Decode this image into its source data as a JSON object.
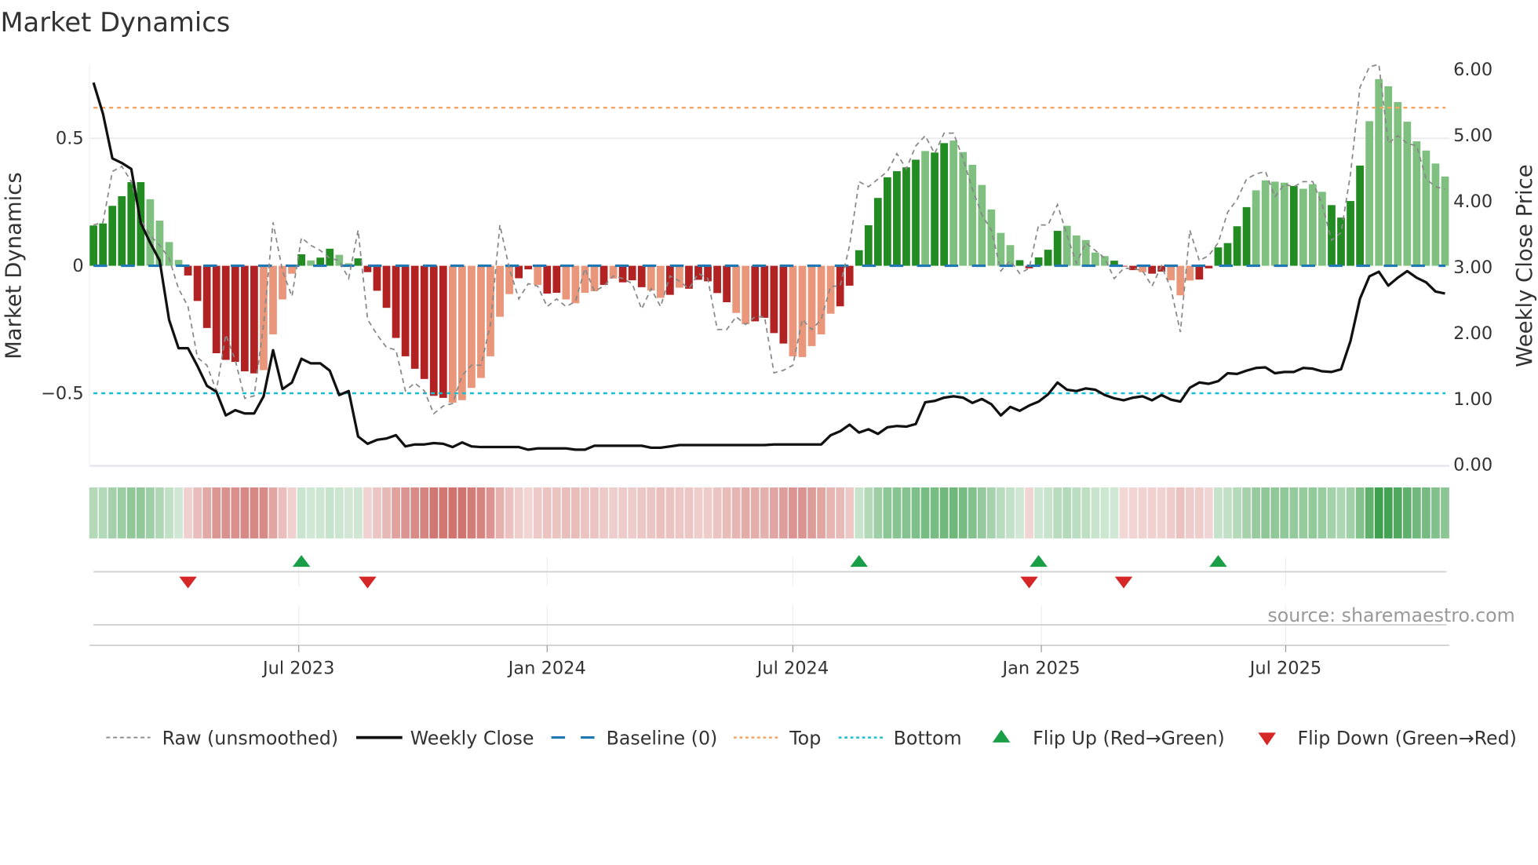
{
  "chart_data": {
    "type": "bar",
    "title": "Market Dynamics",
    "ylabel": "Market Dynamics",
    "ylabel_right": "Weekly Close Price",
    "frequency": "weekly",
    "start_week": "2023-01-30",
    "ylim": [
      -0.78,
      0.79
    ],
    "ylim_right": [
      0,
      6.1
    ],
    "yticks": [
      {
        "v": 0.5,
        "label": "0.5"
      },
      {
        "v": 0,
        "label": "0"
      },
      {
        "v": -0.5,
        "label": "−0.5"
      }
    ],
    "yticks_right": [
      {
        "v": 6,
        "label": "6.00"
      },
      {
        "v": 5,
        "label": "5.00"
      },
      {
        "v": 4,
        "label": "4.00"
      },
      {
        "v": 3,
        "label": "3.00"
      },
      {
        "v": 2,
        "label": "2.00"
      },
      {
        "v": 1,
        "label": "1.00"
      },
      {
        "v": 0,
        "label": "0.00"
      }
    ],
    "xticks": [
      {
        "date": "2023-07-01",
        "label": "Jul 2023"
      },
      {
        "date": "2024-01-01",
        "label": "Jan 2024"
      },
      {
        "date": "2024-07-01",
        "label": "Jul 2024"
      },
      {
        "date": "2025-01-01",
        "label": "Jan 2025"
      },
      {
        "date": "2025-07-01",
        "label": "Jul 2025"
      }
    ],
    "top_level": 0.62,
    "bottom_level": -0.5,
    "baseline": 0,
    "values": [
      0.158,
      0.166,
      0.235,
      0.273,
      0.328,
      0.328,
      0.261,
      0.177,
      0.093,
      0.023,
      -0.038,
      -0.138,
      -0.244,
      -0.343,
      -0.369,
      -0.377,
      -0.414,
      -0.422,
      -0.409,
      -0.269,
      -0.132,
      -0.031,
      0.045,
      0.021,
      0.032,
      0.067,
      0.043,
      0.01,
      0.029,
      -0.025,
      -0.098,
      -0.165,
      -0.283,
      -0.355,
      -0.404,
      -0.444,
      -0.51,
      -0.518,
      -0.537,
      -0.527,
      -0.479,
      -0.44,
      -0.355,
      -0.2,
      -0.111,
      -0.049,
      -0.014,
      -0.075,
      -0.109,
      -0.106,
      -0.132,
      -0.147,
      -0.106,
      -0.1,
      -0.075,
      -0.05,
      -0.065,
      -0.057,
      -0.084,
      -0.097,
      -0.126,
      -0.114,
      -0.086,
      -0.09,
      -0.055,
      -0.061,
      -0.107,
      -0.143,
      -0.185,
      -0.229,
      -0.218,
      -0.204,
      -0.264,
      -0.305,
      -0.355,
      -0.358,
      -0.315,
      -0.269,
      -0.188,
      -0.159,
      -0.078,
      0.061,
      0.159,
      0.266,
      0.347,
      0.371,
      0.386,
      0.416,
      0.45,
      0.444,
      0.481,
      0.491,
      0.446,
      0.396,
      0.317,
      0.221,
      0.129,
      0.081,
      0.022,
      -0.01,
      0.033,
      0.063,
      0.137,
      0.157,
      0.119,
      0.101,
      0.052,
      0.038,
      0.02,
      -0.003,
      -0.017,
      -0.025,
      -0.031,
      -0.023,
      -0.057,
      -0.116,
      -0.058,
      -0.054,
      -0.01,
      0.072,
      0.089,
      0.155,
      0.23,
      0.296,
      0.335,
      0.33,
      0.326,
      0.313,
      0.302,
      0.32,
      0.29,
      0.238,
      0.189,
      0.254,
      0.393,
      0.567,
      0.732,
      0.704,
      0.642,
      0.565,
      0.488,
      0.452,
      0.401,
      0.35
    ],
    "shade": "sssssswwwwsssssssswwwwswsswwsssssssssswwwwwwwsswsswwwwswssswwswssssswwsssswwwwwssssssssswsswwwwwwwssssswwwwwssswsswwwsssssswwwwswwwsssswwwwwww",
    "raw": [
      0.16,
      0.17,
      0.37,
      0.39,
      0.33,
      0.18,
      0.12,
      0.08,
      0.03,
      -0.09,
      -0.16,
      -0.36,
      -0.39,
      -0.49,
      -0.27,
      -0.37,
      -0.52,
      -0.51,
      -0.23,
      0.17,
      -0.02,
      -0.12,
      0.11,
      0.08,
      0.06,
      0.03,
      0.02,
      -0.05,
      0.14,
      -0.21,
      -0.27,
      -0.32,
      -0.33,
      -0.49,
      -0.46,
      -0.49,
      -0.58,
      -0.55,
      -0.54,
      -0.43,
      -0.39,
      -0.39,
      -0.23,
      0.16,
      -0.01,
      -0.13,
      -0.07,
      -0.08,
      -0.16,
      -0.13,
      -0.16,
      -0.14,
      -0.01,
      -0.1,
      -0.08,
      -0.04,
      -0.05,
      -0.07,
      -0.17,
      -0.09,
      -0.16,
      -0.04,
      -0.06,
      -0.09,
      -0.03,
      -0.05,
      -0.25,
      -0.25,
      -0.2,
      -0.23,
      -0.2,
      -0.2,
      -0.42,
      -0.41,
      -0.39,
      -0.21,
      -0.25,
      -0.21,
      -0.08,
      -0.08,
      0.08,
      0.33,
      0.31,
      0.34,
      0.37,
      0.44,
      0.38,
      0.47,
      0.51,
      0.44,
      0.52,
      0.52,
      0.42,
      0.3,
      0.2,
      0.14,
      -0.02,
      0.02,
      -0.03,
      -0.01,
      0.16,
      0.16,
      0.24,
      0.12,
      0.01,
      0.09,
      0.06,
      0.03,
      -0.05,
      -0.01,
      -0.01,
      -0.02,
      -0.08,
      0.0,
      -0.09,
      -0.26,
      0.14,
      0.02,
      0.04,
      0.09,
      0.21,
      0.26,
      0.34,
      0.36,
      0.37,
      0.27,
      0.32,
      0.31,
      0.33,
      0.33,
      0.24,
      0.1,
      0.13,
      0.36,
      0.7,
      0.78,
      0.79,
      0.48,
      0.51,
      0.48,
      0.47,
      0.34,
      0.31,
      0.3
    ],
    "close": [
      5.8,
      5.33,
      4.65,
      4.58,
      4.49,
      3.67,
      3.37,
      3.1,
      2.2,
      1.77,
      1.77,
      1.5,
      1.2,
      1.11,
      0.75,
      0.83,
      0.78,
      0.78,
      1.04,
      1.74,
      1.15,
      1.25,
      1.61,
      1.54,
      1.54,
      1.43,
      1.06,
      1.12,
      0.43,
      0.32,
      0.38,
      0.4,
      0.45,
      0.28,
      0.31,
      0.31,
      0.33,
      0.32,
      0.27,
      0.34,
      0.28,
      0.27,
      0.27,
      0.27,
      0.27,
      0.27,
      0.23,
      0.25,
      0.25,
      0.25,
      0.25,
      0.23,
      0.23,
      0.29,
      0.29,
      0.29,
      0.29,
      0.29,
      0.29,
      0.26,
      0.26,
      0.28,
      0.3,
      0.3,
      0.3,
      0.3,
      0.3,
      0.3,
      0.3,
      0.3,
      0.3,
      0.3,
      0.31,
      0.31,
      0.31,
      0.31,
      0.31,
      0.31,
      0.45,
      0.51,
      0.61,
      0.49,
      0.54,
      0.47,
      0.57,
      0.59,
      0.58,
      0.62,
      0.95,
      0.97,
      1.02,
      1.04,
      1.02,
      0.94,
      1.0,
      0.92,
      0.75,
      0.88,
      0.82,
      0.9,
      0.96,
      1.07,
      1.25,
      1.14,
      1.12,
      1.16,
      1.14,
      1.06,
      1.01,
      0.98,
      1.02,
      1.04,
      0.98,
      1.06,
      0.99,
      0.96,
      1.17,
      1.25,
      1.23,
      1.27,
      1.39,
      1.38,
      1.43,
      1.47,
      1.48,
      1.39,
      1.41,
      1.41,
      1.47,
      1.46,
      1.42,
      1.41,
      1.45,
      1.88,
      2.52,
      2.86,
      2.93,
      2.72,
      2.84,
      2.94,
      2.84,
      2.77,
      2.63,
      2.6
    ],
    "flip_up_weeks": [
      23,
      82,
      101,
      120
    ],
    "flip_down_weeks": [
      11,
      30,
      100,
      110
    ],
    "colors": {
      "pos_strong": "#228B22",
      "pos_weak": "#7FBF7F",
      "neg_strong": "#B22222",
      "neg_weak": "#E9967A",
      "raw": "#888888",
      "close": "#111111",
      "baseline": "#1F77B4",
      "top": "#F4A460",
      "bottom": "#17BECF",
      "flip_up": "#1A9E48",
      "flip_down": "#D62728",
      "strip_pos": "#3A9D4A",
      "strip_neg": "#C24A44"
    },
    "legend": {
      "position": "bottom",
      "items": [
        {
          "key": "raw",
          "label": "Raw (unsmoothed)"
        },
        {
          "key": "close",
          "label": "Weekly Close"
        },
        {
          "key": "baseline",
          "label": "Baseline (0)"
        },
        {
          "key": "top",
          "label": "Top"
        },
        {
          "key": "bottom",
          "label": "Bottom"
        },
        {
          "key": "flip_up",
          "label": "Flip Up (Red→Green)"
        },
        {
          "key": "flip_down",
          "label": "Flip Down (Green→Red)"
        }
      ]
    },
    "source": "source: sharemaestro.com"
  }
}
